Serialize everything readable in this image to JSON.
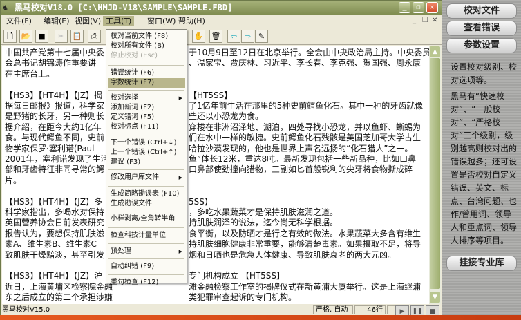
{
  "window": {
    "title": "黑马校对V18.0  [C:\\HMJD-V18\\SAMPLE\\SAMPLE.FBD]"
  },
  "menubar": [
    {
      "label": "文件(F)"
    },
    {
      "label": "编辑(E)"
    },
    {
      "label": "视图(V)"
    },
    {
      "label": "工具(T)"
    },
    {
      "label": "窗口(W)"
    },
    {
      "label": "帮助(H)"
    }
  ],
  "tools_menu": {
    "items": [
      {
        "label": "校对当前文件 (F8)"
      },
      {
        "label": "校对所有文件 (B)"
      },
      {
        "label": "停止校对 (Esc)"
      },
      {
        "label": "错误统计 (F6)"
      },
      {
        "label": "字数统计 (F7)"
      },
      {
        "label": "校对选择"
      },
      {
        "label": "添加新词 (F2)"
      },
      {
        "label": "定义错词 (F5)"
      },
      {
        "label": "校对标点 (F11)"
      },
      {
        "label": "下一个错误 (Ctrl+↓)"
      },
      {
        "label": "上一个错误 (Ctrl+↑)"
      },
      {
        "label": "建议 (F3)"
      },
      {
        "label": "修改用户库文件"
      },
      {
        "label": "生成简略勘误表 (F10)"
      },
      {
        "label": "生成勘误文件"
      },
      {
        "label": "小样剥离/全角转半角"
      },
      {
        "label": "检查科技计量单位"
      },
      {
        "label": "预处理"
      },
      {
        "label": "自动纠错 (F9)"
      },
      {
        "label": "重句检查 (F12)"
      }
    ]
  },
  "document": {
    "lines": [
      {
        "l": "中国共产党第十七届中央委",
        "r": "于10月9日至12日在北京举行。全会由中央政治局主持。中央委员"
      },
      {
        "l": "会总书记胡锦涛作重要讲",
        "r": "、温家宝、贾庆林、习近平、李长春、李克强、贺国强、周永康"
      },
      {
        "l": "在主席台上。",
        "r": ""
      },
      {
        "l": "",
        "r": ""
      },
      {
        "l": "【HS3】【HT4H】【JZ】揭",
        "r": "【HT5SS】"
      },
      {
        "l": "据每日邮报》报道，科学家",
        "r": "了1亿年前生活在那里的5种史前鳄鱼化石。其中一种的牙齿就像"
      },
      {
        "l": "是野猪的长牙，另一种则长",
        "r": "些还以小恐龙为食。"
      },
      {
        "l": "据介绍，在距今大约1亿年",
        "r": "穿梭在非洲沼泽地、湖泊，四处寻找小恐龙，并以鱼虾、蜥蜴为"
      },
      {
        "l": "食。与现代鳄鱼不同，史前",
        "r": "们在水中一样的敏捷。史前鳄鱼化石残骸是美国芝加哥大学古生"
      },
      {
        "l": "物学家保罗·塞利诺(Paul",
        "r": "哈拉沙漠发现的，他也是世界上声名远扬的“化石猎人”之一。"
      },
      {
        "l": "2001年，塞利诺发现了生活",
        "r": "鱼”体长12米，重达8吨。最新发现包括一些新品种，比如口鼻"
      },
      {
        "l": "部和牙齿特征非同寻常的鳄",
        "r": "口鼻部使劲撞向猎物，三副如匕首般锐利的尖牙将食物撕成碎"
      },
      {
        "l": "片。",
        "r": ""
      },
      {
        "l": "",
        "r": ""
      },
      {
        "l": "【HS3】【HT4H】【JZ】多",
        "r": "5SS】"
      },
      {
        "l": "科学家指出，多喝水对保持",
        "r": "，多吃水果蔬菜才是保持肌肤滋润之道。"
      },
      {
        "l": "英国营养协会日前发表研究",
        "r": "持肌肤润泽的说法，迄今尚无科学根据。"
      },
      {
        "l": "报告认为，要想保持肌肤滋",
        "r": "食平衡，以及防晒才是行之有效的做法。水果蔬菜大多含有维生"
      },
      {
        "l": "素A、维生素B、维生素C",
        "r": "持肌肤细胞健康非常重要，能够清楚毒素。如果摄取不足，将导"
      },
      {
        "l": "致肌肤干燥黯淡，甚至引发",
        "r": "烟和日晒也是危急人体健康、导致肌肤衰老的两大元凶。"
      },
      {
        "l": "",
        "r": ""
      },
      {
        "l": "【HS3】【HT4H】【JZ】沪",
        "r": "专门机构成立 【HT5SS】"
      },
      {
        "l": "近日，上海黄埔区检察院金融",
        "r": "滩金融检察工作室的揭牌仪式在新黄浦大厦举行。这是上海继浦"
      },
      {
        "l": "东之后成立的第二个承担涉嫌",
        "r": "类犯罪审查起诉的专门机构。"
      }
    ]
  },
  "status": {
    "app": "黑马校对V15.0",
    "mode": "严格, 自动",
    "lines": "46行"
  },
  "panel": {
    "buttons": [
      "校对文件",
      "查看错误",
      "参数设置"
    ],
    "desc1": "设置校对级别、校对选项等。",
    "desc2": "黑马有“快速校对”、“一般校对”、“严格校对”三个级别，级别越高则校对出的错误越多；还可设置是否校对自定义错误、英文、标点、台湾问题、也作/曾用词、领导人和重点词、领导人排序等项目。",
    "bottom_button": "挂接专业库"
  }
}
